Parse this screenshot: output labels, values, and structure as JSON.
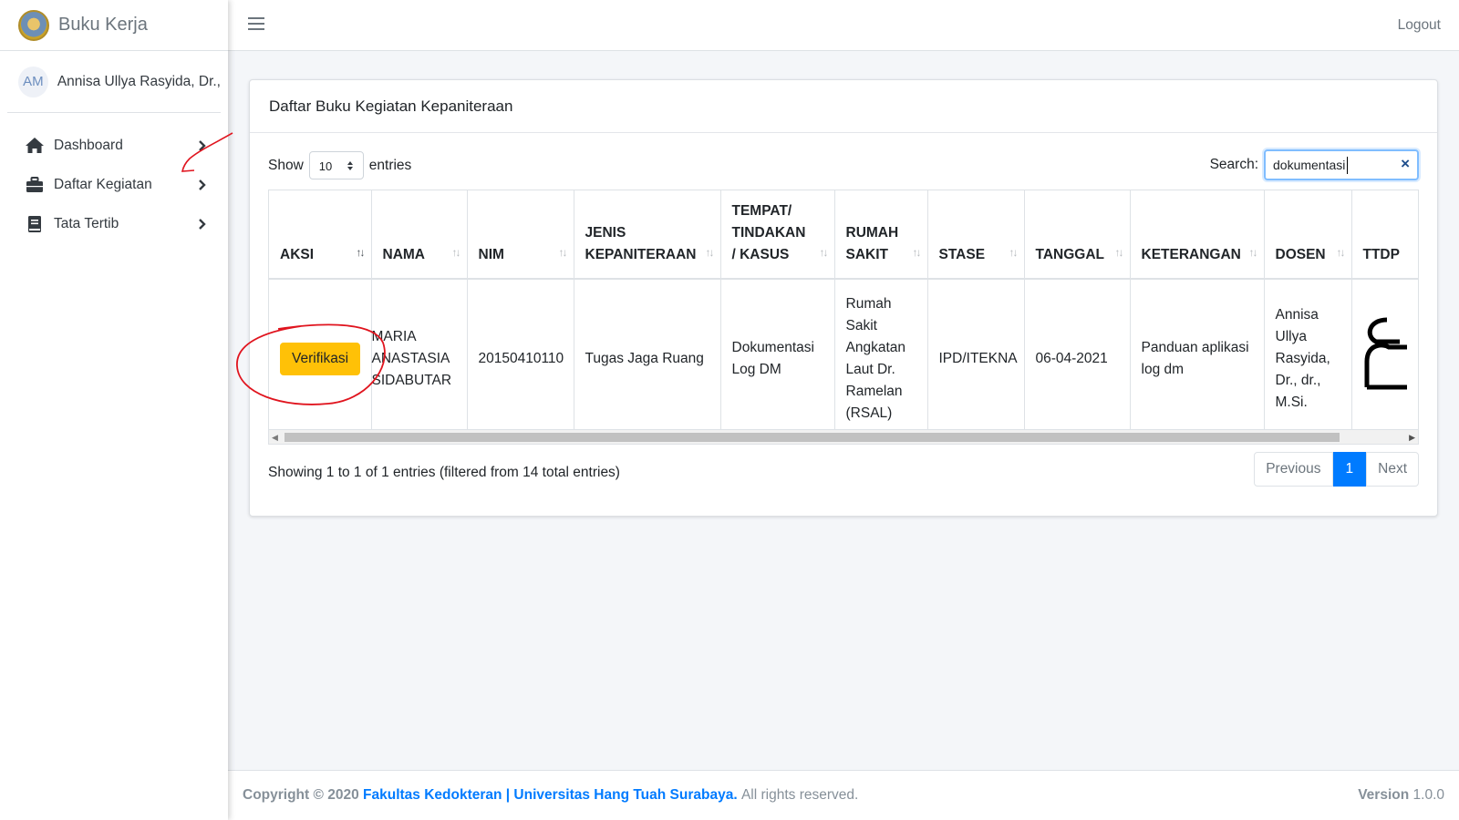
{
  "brand": {
    "title": "Buku Kerja"
  },
  "user": {
    "initials": "AM",
    "name": "Annisa Ullya Rasyida, Dr.,"
  },
  "sidebar": {
    "items": [
      {
        "label": "Dashboard",
        "icon": "home-icon"
      },
      {
        "label": "Daftar Kegiatan",
        "icon": "briefcase-icon"
      },
      {
        "label": "Tata Tertib",
        "icon": "book-icon"
      }
    ]
  },
  "topbar": {
    "logout": "Logout",
    "menu_icon": "hamburger-icon"
  },
  "card": {
    "title": "Daftar Buku Kegiatan Kepaniteraan"
  },
  "controls": {
    "show_label": "Show",
    "entries_value": "10",
    "entries_label": "entries",
    "search_label": "Search:",
    "search_value": "dokumentasi"
  },
  "table": {
    "headers": [
      {
        "lines": [
          "AKSI"
        ]
      },
      {
        "lines": [
          "NAMA"
        ]
      },
      {
        "lines": [
          "NIM"
        ]
      },
      {
        "lines": [
          "JENIS",
          "KEPANITERAAN"
        ]
      },
      {
        "lines": [
          "TEMPAT/",
          "TINDAKAN",
          "/ KASUS"
        ]
      },
      {
        "lines": [
          "RUMAH",
          "SAKIT"
        ]
      },
      {
        "lines": [
          "STASE"
        ]
      },
      {
        "lines": [
          "TANGGAL"
        ]
      },
      {
        "lines": [
          "KETERANGAN"
        ]
      },
      {
        "lines": [
          "DOSEN"
        ]
      },
      {
        "lines": [
          "TTDP"
        ]
      }
    ],
    "rows": [
      {
        "aksi": "Verifikasi",
        "nama": [
          "MARIA",
          "ANASTASIA",
          "SIDABUTAR"
        ],
        "nim": "20150410110",
        "jenis": "Tugas Jaga Ruang",
        "tempat": [
          "Dokumentasi",
          "Log DM"
        ],
        "rumah_sakit": [
          "Rumah",
          "Sakit",
          "Angkatan",
          "Laut Dr.",
          "Ramelan",
          "(RSAL)"
        ],
        "stase": "IPD/ITEKNA",
        "tanggal": "06-04-2021",
        "keterangan": [
          "Panduan aplikasi",
          "log dm"
        ],
        "dosen": [
          "Annisa",
          "Ullya",
          "Rasyida,",
          "Dr., dr.,",
          "M.Si."
        ]
      }
    ]
  },
  "info": "Showing 1 to 1 of 1 entries (filtered from 14 total entries)",
  "pagination": {
    "previous": "Previous",
    "current": "1",
    "next": "Next"
  },
  "footer": {
    "copyright": "Copyright © 2020",
    "org": "Fakultas Kedokteran | Universitas Hang Tuah Surabaya.",
    "rights": "All rights reserved.",
    "version_label": "Version",
    "version": "1.0.0"
  },
  "colors": {
    "primary": "#007bff",
    "warning": "#ffc107",
    "annotation": "#e0141e"
  }
}
